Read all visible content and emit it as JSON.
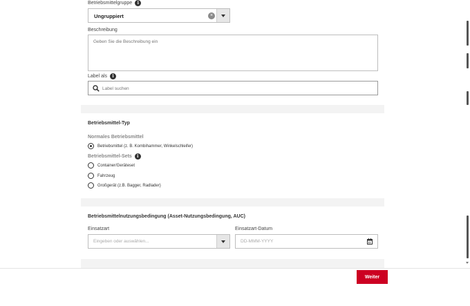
{
  "form": {
    "group_label": "Betriebsmittelgruppe",
    "group_value": "Ungruppiert",
    "description_label": "Beschreibung",
    "description_placeholder": "Geben Sie die Beschreibung ein",
    "label_as": "Label als",
    "label_search_placeholder": "Label suchen"
  },
  "type_section": {
    "title": "Betriebsmittel-Typ",
    "normal_title": "Normales Betriebsmittel",
    "normal_option": "Betriebsmittel (z. B. Kombihammer, Winkelschleifer)",
    "sets_title": "Betriebsmittel-Sets",
    "set_options": [
      "Container/Geräteset",
      "Fahrzeug",
      "Großgerät (z.B. Bagger, Radlader)"
    ]
  },
  "auc_section": {
    "title": "Betriebsmittelnutzungsbedingung (Asset-Nutzungsbedingung, AUC)",
    "use_type_label": "Einsatzart",
    "use_type_placeholder": "Eingeben oder auswählen...",
    "date_label": "Einsatzart-Datum",
    "date_placeholder": "DD-MMM-YYYY"
  },
  "footer": {
    "next_button": "Weiter"
  },
  "icons": {
    "info": "info-icon",
    "clear": "clear-icon",
    "dropdown": "chevron-down-icon",
    "search": "search-icon",
    "calendar": "calendar-icon"
  },
  "colors": {
    "primary_button": "#cc0022",
    "section_bg": "#f3f3f3"
  }
}
